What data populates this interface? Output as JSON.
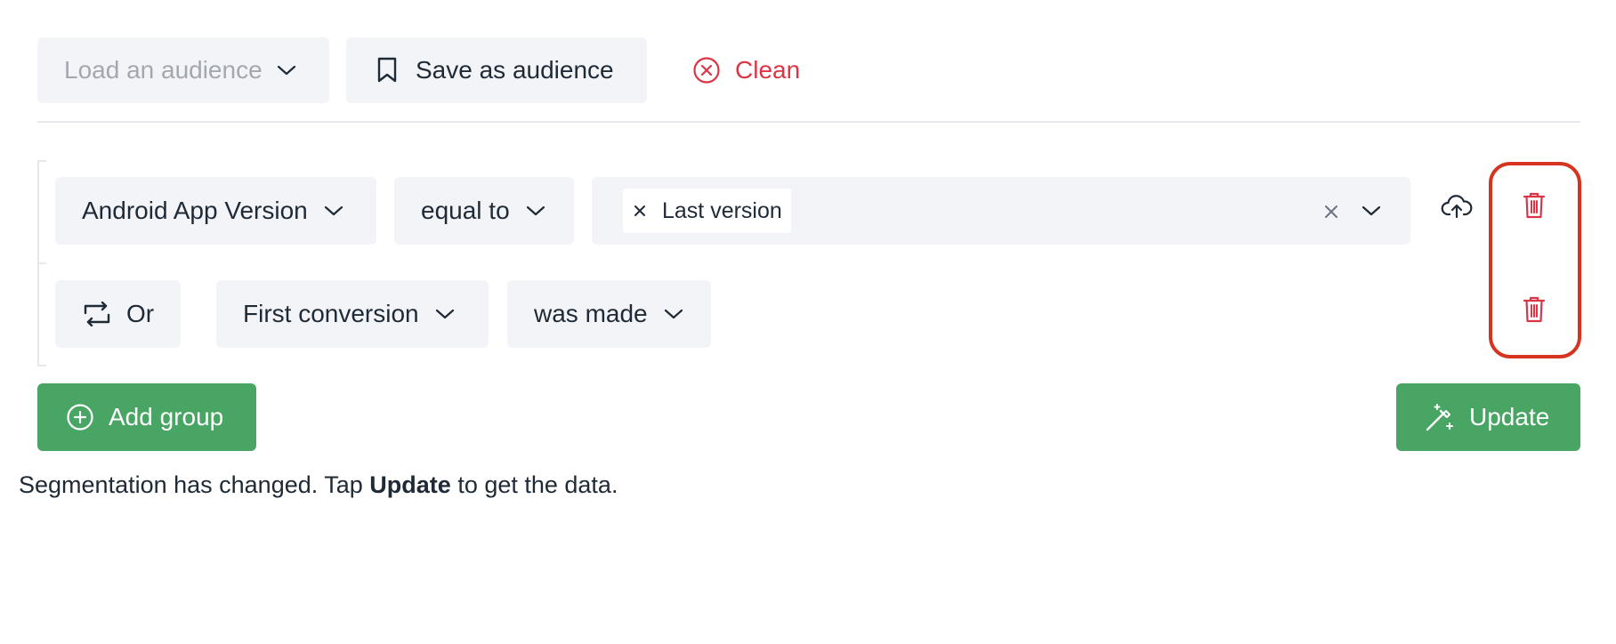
{
  "toolbar": {
    "load_placeholder": "Load an audience",
    "save_label": "Save as audience",
    "clean_label": "Clean"
  },
  "rule1": {
    "field": "Android App Version",
    "operator": "equal to",
    "tag": "Last version"
  },
  "rule2": {
    "connector": "Or",
    "field": "First conversion",
    "operator": "was made"
  },
  "actions": {
    "add_group": "Add group",
    "update": "Update"
  },
  "status": {
    "prefix": "Segmentation has changed. Tap ",
    "bold": "Update",
    "suffix": " to get the data."
  },
  "colors": {
    "danger": "#dc3545",
    "primary_green": "#48a564",
    "highlight": "#d6341f",
    "pill_bg": "#f3f4f7"
  },
  "icons": [
    "chevron-down-icon",
    "bookmark-icon",
    "circle-x-icon",
    "close-icon",
    "cloud-upload-icon",
    "trash-icon",
    "repeat-icon",
    "plus-circle-icon",
    "magic-wand-icon"
  ]
}
